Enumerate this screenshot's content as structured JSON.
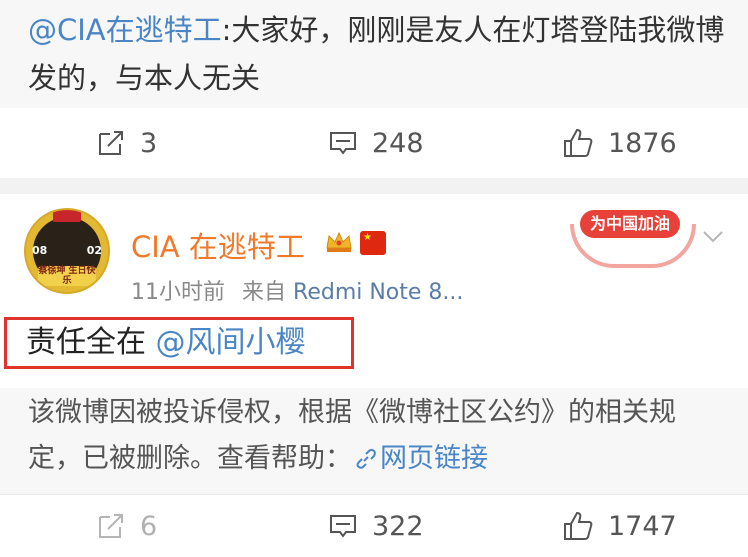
{
  "repost": {
    "mention": "@CIA在逃特工",
    "text": ":大家好，刚刚是友人在灯塔登陆我微博发的，与本人无关"
  },
  "repost_actions": {
    "reposts": "3",
    "comments": "248",
    "likes": "1876"
  },
  "post": {
    "avatar": {
      "left_number": "08",
      "right_number": "02",
      "caption": "蔡徐坤 生日快乐"
    },
    "username": "CIA 在逃特工",
    "time": "11小时前",
    "source_prefix": "来自",
    "source": "Redmi Note 8...",
    "badge_label": "为中国加油",
    "text_prefix": "责任全在",
    "text_mention": "@风间小樱",
    "notice_text": "该微博因被投诉侵权，根据《微博社区公约》的相关规定，已被删除。查看帮助：",
    "notice_link": "网页链接"
  },
  "post_actions": {
    "reposts": "6",
    "comments": "322",
    "likes": "1747"
  },
  "colors": {
    "username": "#f07a2a",
    "link": "#4a86c6",
    "highlight": "#e0332c"
  },
  "icons": {
    "repost": "share-arrow-icon",
    "comment": "comment-bubble-icon",
    "like": "thumbs-up-icon",
    "vip": "vip-crown-icon",
    "flag": "china-flag-icon",
    "more": "chevron-down-icon",
    "link": "link-icon"
  }
}
